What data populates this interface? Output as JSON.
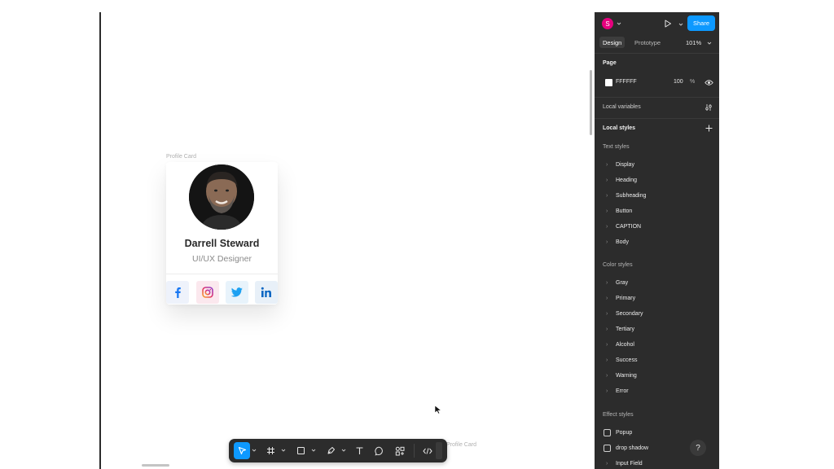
{
  "canvas": {
    "frame_label": "Profile Card",
    "frame_label_2": "Profile Card"
  },
  "card": {
    "name": "Darrell Steward",
    "role": "UI/UX Designer",
    "social": [
      "facebook-icon",
      "instagram-icon",
      "twitter-icon",
      "linkedin-icon"
    ],
    "colors": {
      "facebook": "#1877f2",
      "instagram": "#e1306c",
      "twitter": "#1da1f2",
      "linkedin": "#0a66c2"
    }
  },
  "toolbar": {
    "tools": [
      "move-tool",
      "frame-tool",
      "shape-tool",
      "pen-tool",
      "text-tool",
      "comment-tool",
      "resources-tool",
      "dev-mode-toggle"
    ],
    "active_tool": "move-tool"
  },
  "panel": {
    "user_initial": "S",
    "share_label": "Share",
    "tabs": {
      "design": "Design",
      "prototype": "Prototype"
    },
    "zoom": "101%",
    "page": {
      "title": "Page",
      "color_hex": "FFFFFF",
      "opacity": "100",
      "opacity_unit": "%"
    },
    "local_variables": "Local variables",
    "local_styles": "Local styles",
    "text_styles": {
      "title": "Text styles",
      "items": [
        "Display",
        "Heading",
        "Subheading",
        "Button",
        "CAPTION",
        "Body"
      ]
    },
    "color_styles": {
      "title": "Color styles",
      "items": [
        "Gray",
        "Primary",
        "Secondary",
        "Tertiary",
        "Alcohol",
        "Success",
        "Warning",
        "Error"
      ]
    },
    "effect_styles": {
      "title": "Effect styles",
      "items": [
        "Popup",
        "drop shadow",
        "Input Field"
      ]
    },
    "help": "?"
  },
  "colors": {
    "accent": "#0d99ff",
    "panel_bg": "#2c2c2c",
    "avatar": "#e6007e"
  }
}
